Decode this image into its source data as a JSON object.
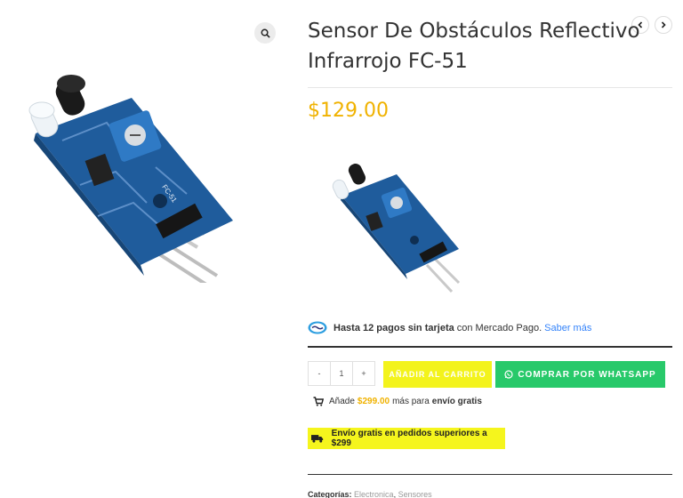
{
  "gallery": {
    "zoom_icon": "search-icon",
    "image_alt": "FC-51"
  },
  "product": {
    "title": "Sensor De Obstáculos Reflectivo Infrarrojo FC-51",
    "price": "$129.00",
    "accent_color": "#f0b200"
  },
  "nav": {
    "prev_icon": "chevron-left-icon",
    "next_icon": "chevron-right-icon"
  },
  "mercadopago": {
    "bold_text": "Hasta 12 pagos sin tarjeta",
    "rest_text": "con Mercado Pago.",
    "link_text": "Saber más"
  },
  "cart": {
    "minus_label": "-",
    "quantity": "1",
    "plus_label": "+",
    "add_to_cart_label": "AÑADIR AL CARRITO",
    "whatsapp_label": "COMPRAR POR WHATSAPP",
    "add_cart_color": "#f3f31c",
    "whatsapp_color": "#28c96a"
  },
  "shipping": {
    "prefix": "Añade",
    "amount": "$299.00",
    "middle": "más para",
    "bold": "envío gratis",
    "banner": "Envío gratis en pedidos superiores a $299"
  },
  "meta": {
    "categories_label": "Categorías:",
    "category_1": "Electronica",
    "separator": ",",
    "category_2": "Sensores"
  }
}
